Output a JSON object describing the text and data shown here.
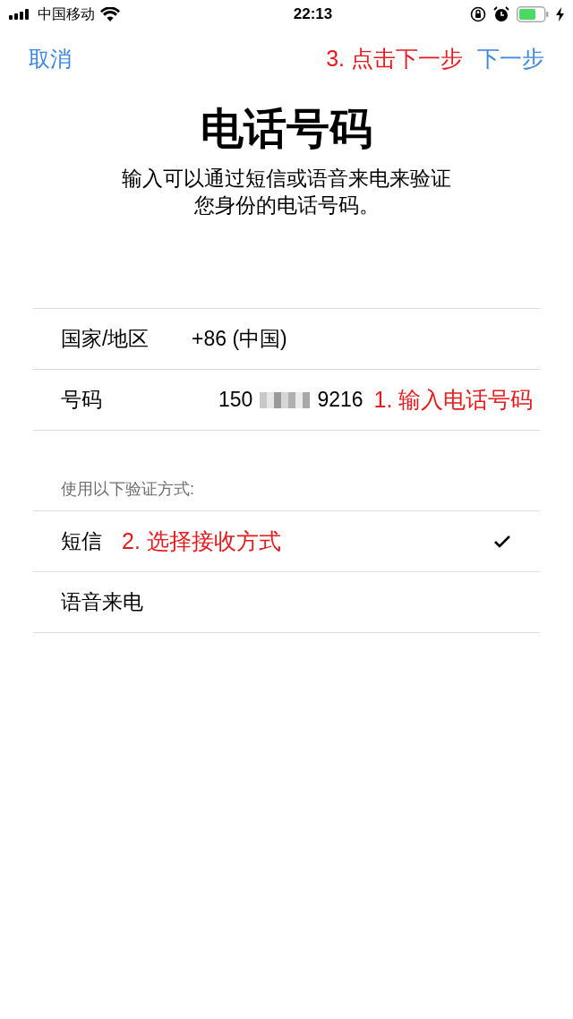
{
  "status_bar": {
    "carrier": "中国移动",
    "time": "22:13"
  },
  "nav": {
    "cancel": "取消",
    "annotation": "3. 点击下一步",
    "next": "下一步"
  },
  "title": "电话号码",
  "subtitle": [
    "输入可以通过短信或语音来电来验证",
    "您身份的电话号码。"
  ],
  "fields": [
    {
      "label": "国家/地区",
      "value": "+86 (中国)"
    },
    {
      "label": "号码",
      "value_start": "150",
      "value_end": "9216",
      "annotation": "1. 输入电话号码"
    }
  ],
  "method_header": "使用以下验证方式:",
  "methods": [
    {
      "label": "短信",
      "annotation": "2. 选择接收方式",
      "selected": true
    },
    {
      "label": "语音来电",
      "selected": false
    }
  ]
}
